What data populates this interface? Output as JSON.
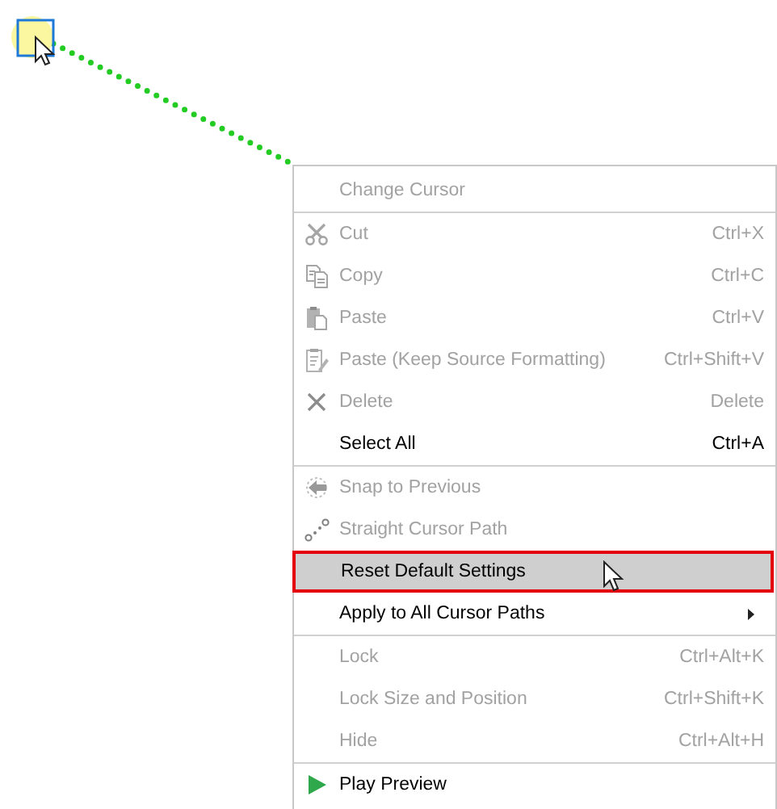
{
  "context_menu": {
    "items": [
      {
        "kind": "header",
        "label": "Change Cursor",
        "disabled": true,
        "selected": false
      },
      {
        "kind": "separator"
      },
      {
        "kind": "item",
        "label": "Cut",
        "shortcut": "Ctrl+X",
        "disabled": true,
        "selected": false
      },
      {
        "kind": "item",
        "label": "Copy",
        "shortcut": "Ctrl+C",
        "disabled": true,
        "selected": false
      },
      {
        "kind": "item",
        "label": "Paste",
        "shortcut": "Ctrl+V",
        "disabled": true,
        "selected": false
      },
      {
        "kind": "item",
        "label": "Paste (Keep Source Formatting)",
        "shortcut": "Ctrl+Shift+V",
        "disabled": true,
        "selected": false
      },
      {
        "kind": "item",
        "label": "Delete",
        "shortcut": "Delete",
        "disabled": true,
        "selected": false
      },
      {
        "kind": "item",
        "label": "Select All",
        "shortcut": "Ctrl+A",
        "disabled": false,
        "selected": false
      },
      {
        "kind": "separator"
      },
      {
        "kind": "item",
        "label": "Snap to Previous",
        "disabled": true,
        "selected": false
      },
      {
        "kind": "item",
        "label": "Straight Cursor Path",
        "disabled": true,
        "selected": false
      },
      {
        "kind": "item",
        "label": "Reset Default Settings",
        "disabled": false,
        "selected": true
      },
      {
        "kind": "submenu",
        "label": "Apply to All Cursor Paths",
        "disabled": false,
        "selected": false
      },
      {
        "kind": "separator"
      },
      {
        "kind": "item",
        "label": "Lock",
        "shortcut": "Ctrl+Alt+K",
        "disabled": true,
        "selected": false
      },
      {
        "kind": "item",
        "label": "Lock Size and Position",
        "shortcut": "Ctrl+Shift+K",
        "disabled": true,
        "selected": false
      },
      {
        "kind": "item",
        "label": "Hide",
        "shortcut": "Ctrl+Alt+H",
        "disabled": true,
        "selected": false
      },
      {
        "kind": "separator"
      },
      {
        "kind": "item",
        "label": "Play Preview",
        "disabled": false,
        "selected": false
      }
    ]
  }
}
